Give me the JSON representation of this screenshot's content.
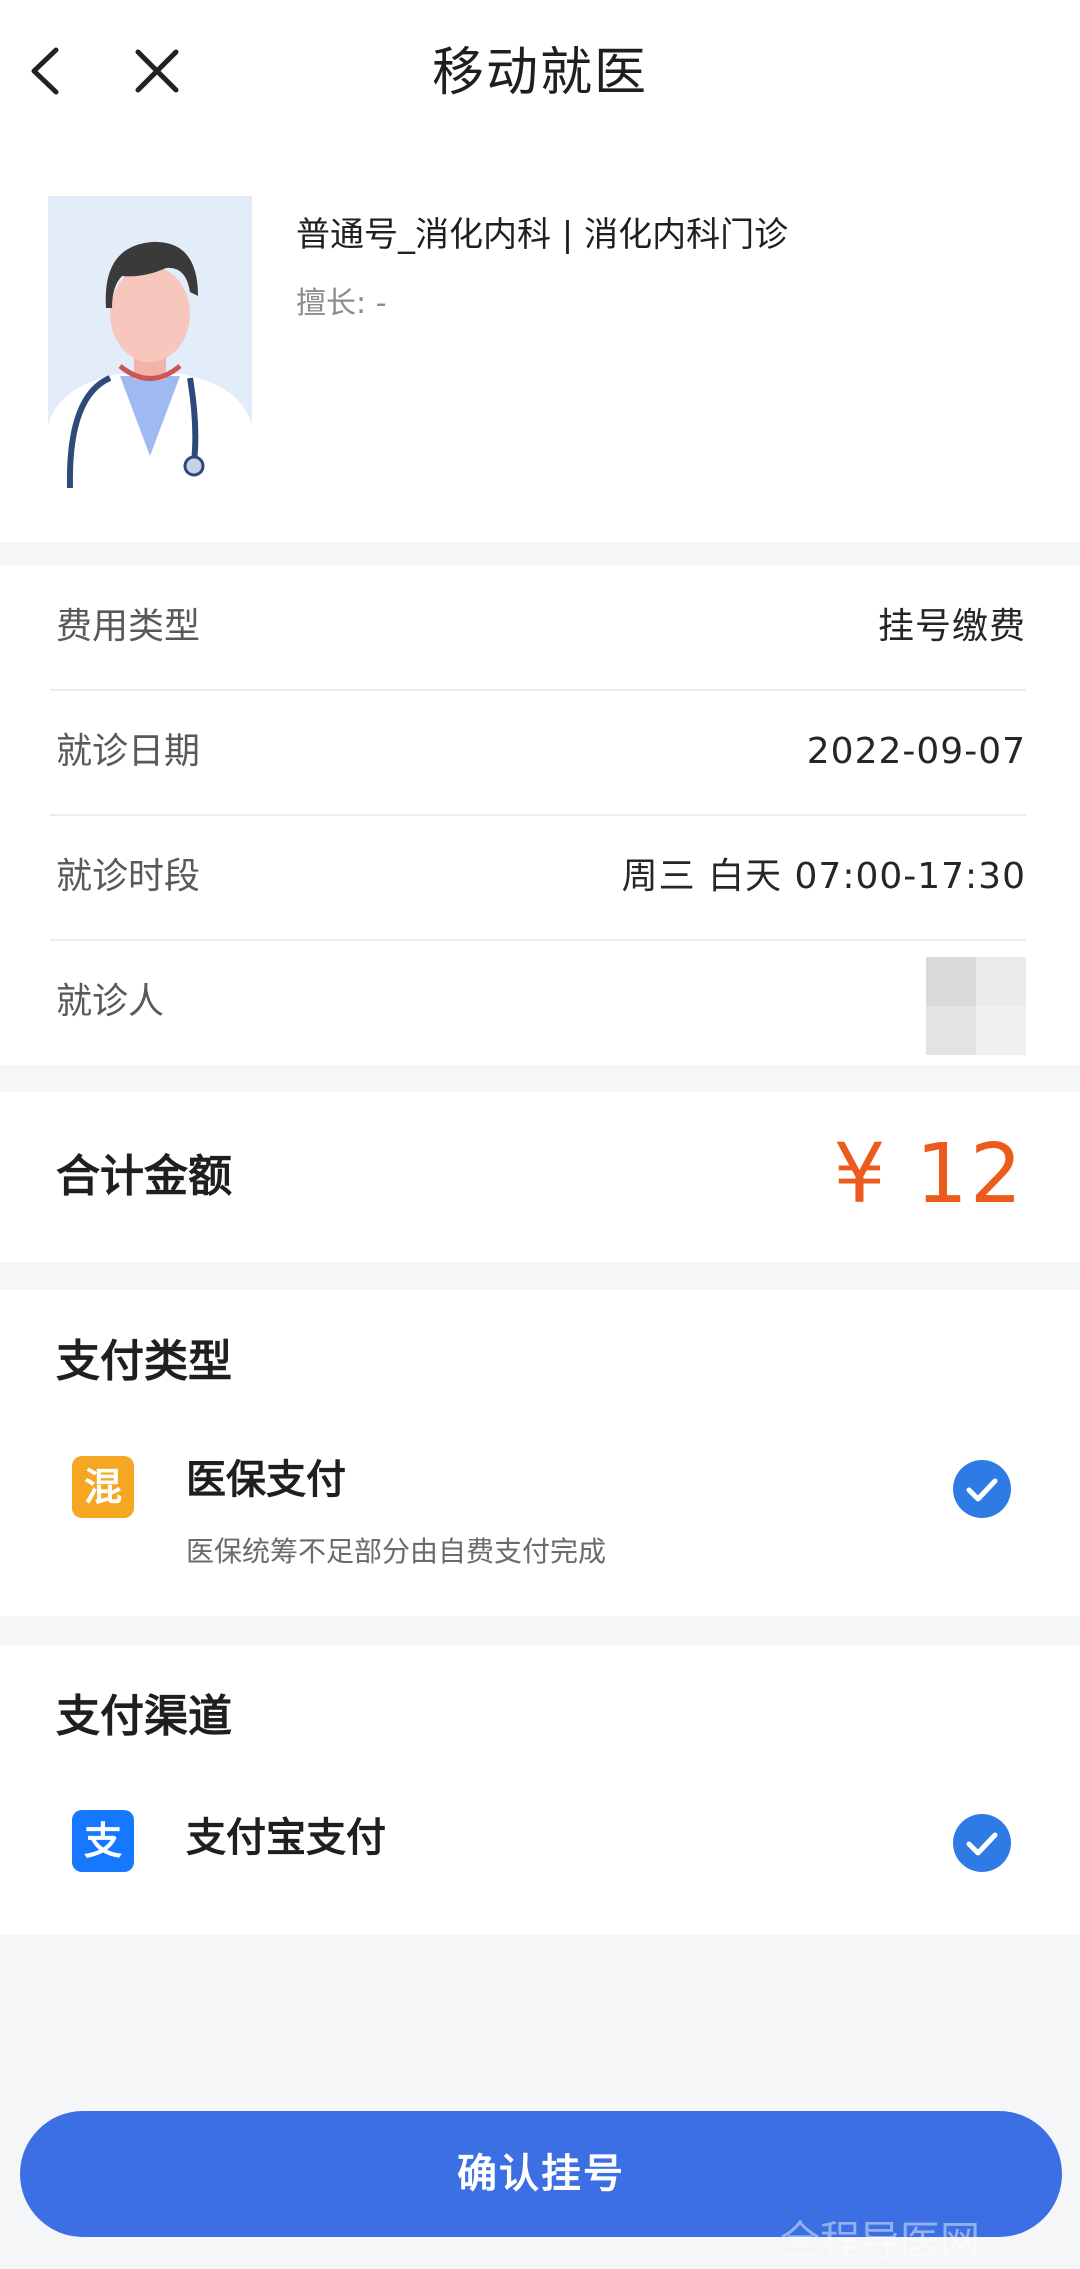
{
  "header": {
    "title": "移动就医",
    "back_icon": "chevron-left-icon",
    "close_icon": "close-icon"
  },
  "doctor": {
    "title": "普通号_消化内科 | 消化内科门诊",
    "specialty": "擅长: -"
  },
  "details": [
    {
      "label": "费用类型",
      "value": "挂号缴费"
    },
    {
      "label": "就诊日期",
      "value": "2022-09-07"
    },
    {
      "label": "就诊时段",
      "value": "周三 白天 07:00-17:30"
    },
    {
      "label": "就诊人",
      "value": ""
    }
  ],
  "total": {
    "label": "合计金额",
    "value": "¥ 12",
    "color": "#ea5b1c"
  },
  "payment_type": {
    "title": "支付类型",
    "option": {
      "icon_text": "混",
      "icon_color": "#f5a623",
      "label": "医保支付",
      "desc": "医保统筹不足部分由自费支付完成",
      "checked": true
    }
  },
  "payment_channel": {
    "title": "支付渠道",
    "option": {
      "icon_text": "支",
      "icon_color": "#1677ff",
      "label": "支付宝支付",
      "checked": true
    }
  },
  "confirm": {
    "label": "确认挂号",
    "color": "#3b6fe3"
  },
  "watermark": "全程导医网"
}
